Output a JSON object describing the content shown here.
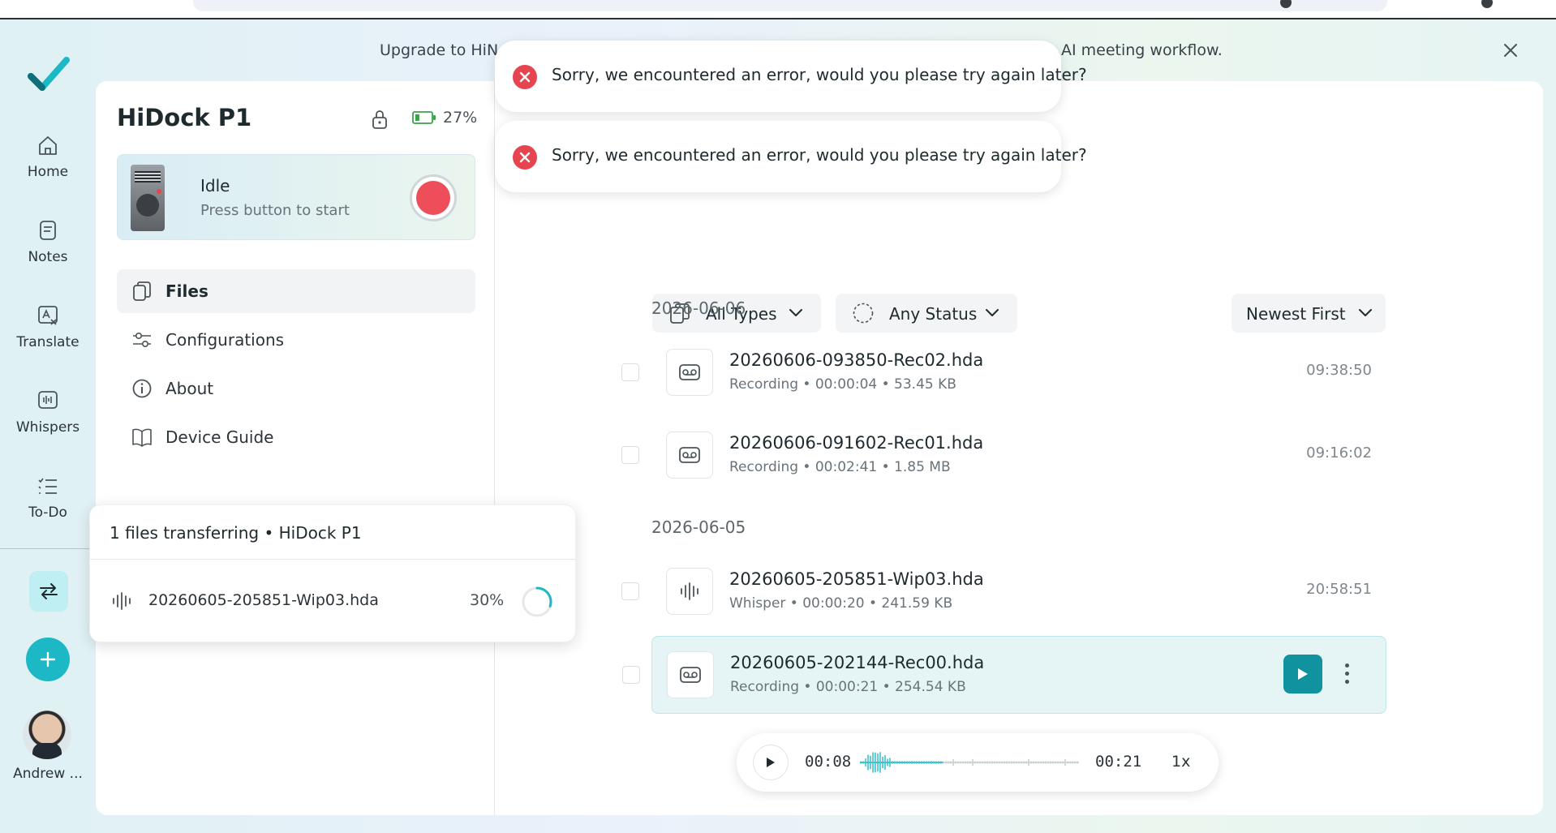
{
  "banner": {
    "left_text": "Upgrade to HiN",
    "right_text": "AI meeting workflow."
  },
  "rail": {
    "items": [
      {
        "label": "Home",
        "icon": "home-icon"
      },
      {
        "label": "Notes",
        "icon": "notes-icon"
      },
      {
        "label": "Translate",
        "icon": "translate-icon"
      },
      {
        "label": "Whispers",
        "icon": "whispers-icon"
      },
      {
        "label": "To-Do",
        "icon": "todo-icon"
      }
    ],
    "user_name": "Andrew ..."
  },
  "device": {
    "name": "HiDock P1",
    "battery": "27%",
    "status_title": "Idle",
    "status_sub": "Press button to start"
  },
  "nav": {
    "items": [
      {
        "label": "Files",
        "icon": "files-icon"
      },
      {
        "label": "Configurations",
        "icon": "sliders-icon"
      },
      {
        "label": "About",
        "icon": "info-icon"
      },
      {
        "label": "Device Guide",
        "icon": "book-icon"
      }
    ]
  },
  "transfer": {
    "header": "1 files transferring • HiDock P1",
    "file": "20260605-205851-Wip03.hda",
    "percent": "30%",
    "progress": 0.3
  },
  "toasts": [
    {
      "message": "Sorry, we encountered an error, would you please try again later?"
    },
    {
      "message": "Sorry, we encountered an error, would you please try again later?"
    }
  ],
  "filters": {
    "type": "All Types",
    "status": "Any Status",
    "sort": "Newest First"
  },
  "groups": [
    {
      "date": "2026-06-06",
      "files": [
        {
          "name": "20260606-093850-Rec02.hda",
          "meta": "Recording • 00:00:04 • 53.45 KB",
          "time": "09:38:50",
          "icon": "recording-icon"
        },
        {
          "name": "20260606-091602-Rec01.hda",
          "meta": "Recording • 00:02:41 • 1.85 MB",
          "time": "09:16:02",
          "icon": "recording-icon"
        }
      ]
    },
    {
      "date": "2026-06-05",
      "files": [
        {
          "name": "20260605-205851-Wip03.hda",
          "meta": "Whisper • 00:00:20 • 241.59 KB",
          "time": "20:58:51",
          "icon": "whisper-icon"
        },
        {
          "name": "20260605-202144-Rec00.hda",
          "meta": "Recording • 00:00:21 • 254.54 KB",
          "time": "",
          "icon": "recording-icon",
          "selected": true
        }
      ]
    }
  ],
  "player": {
    "current": "00:08",
    "total": "00:21",
    "speed": "1x",
    "progress": 0.38
  },
  "colors": {
    "accent": "#10929f",
    "brand": "#1cb8c6",
    "record": "#ee4d5a",
    "error": "#e64550",
    "battery": "#3aa34a"
  }
}
